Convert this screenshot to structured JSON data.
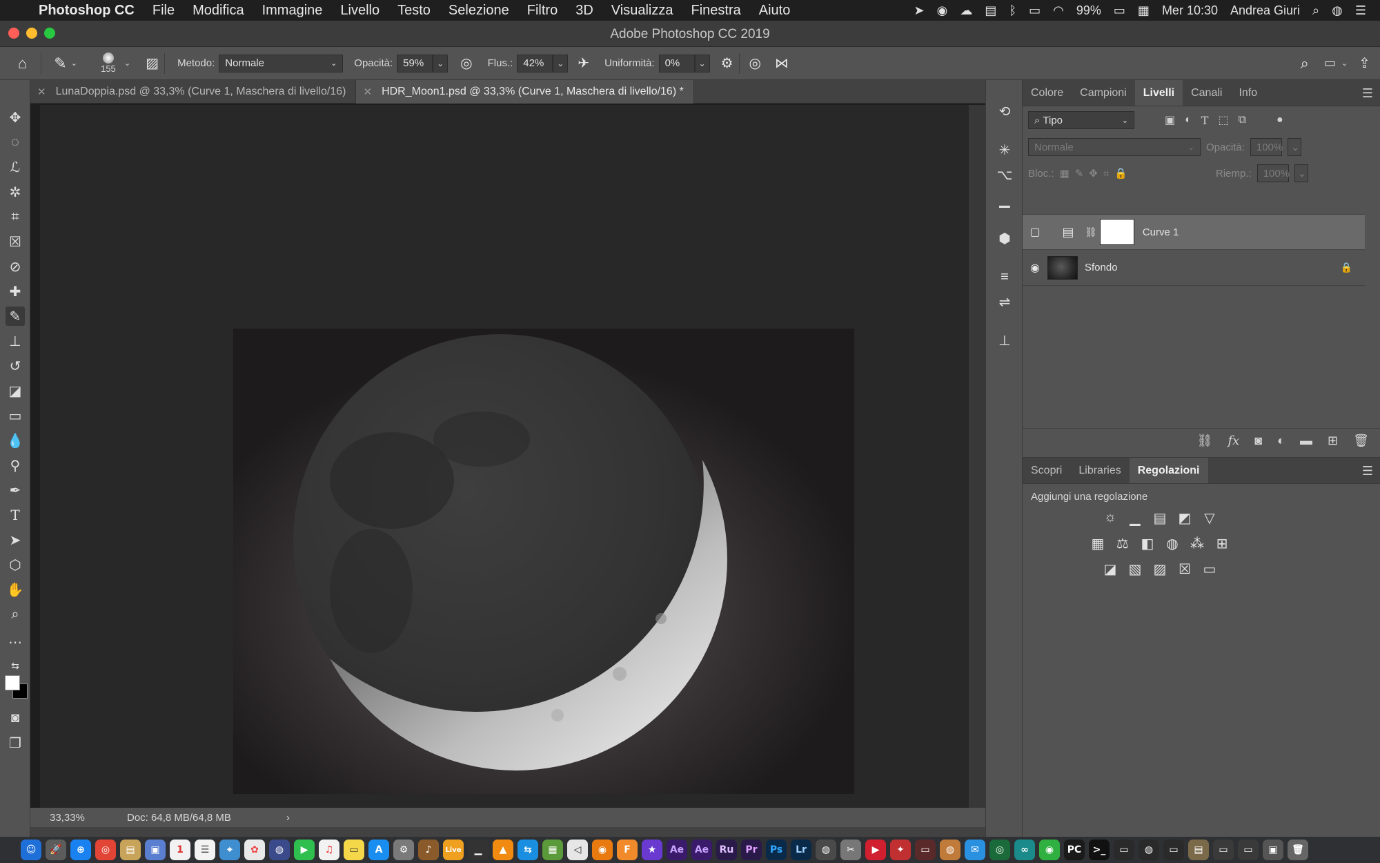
{
  "menubar": {
    "app_name": "Photoshop CC",
    "items": [
      "File",
      "Modifica",
      "Immagine",
      "Livello",
      "Testo",
      "Selezione",
      "Filtro",
      "3D",
      "Visualizza",
      "Finestra",
      "Aiuto"
    ],
    "battery": "99%",
    "clock": "Mer 10:30",
    "user": "Andrea Giuri"
  },
  "window": {
    "title": "Adobe Photoshop CC 2019"
  },
  "options": {
    "brush_size": "155",
    "metodo_label": "Metodo:",
    "metodo_value": "Normale",
    "opacita_label": "Opacità:",
    "opacita_value": "59%",
    "flusso_label": "Flus.:",
    "flusso_value": "42%",
    "uniformita_label": "Uniformità:",
    "uniformita_value": "0%"
  },
  "tabs": [
    {
      "label": "LunaDoppia.psd @ 33,3% (Curve 1, Maschera di livello/16)"
    },
    {
      "label": "HDR_Moon1.psd @ 33,3% (Curve 1, Maschera di livello/16) *"
    }
  ],
  "status": {
    "zoom": "33,33%",
    "doc": "Doc: 64,8 MB/64,8 MB"
  },
  "panel_top": {
    "tabs": [
      "Colore",
      "Campioni",
      "Livelli",
      "Canali",
      "Info"
    ],
    "active_tab": "Livelli",
    "filter_value": "Tipo",
    "blend_value": "Normale",
    "opacity_label": "Opacità:",
    "opacity_value": "100%",
    "lock_label": "Bloc.:",
    "fill_label": "Riemp.:",
    "fill_value": "100%",
    "layers": [
      {
        "name": "Curve 1"
      },
      {
        "name": "Sfondo"
      }
    ]
  },
  "panel_bottom": {
    "tabs": [
      "Scopri",
      "Libraries",
      "Regolazioni"
    ],
    "active_tab": "Regolazioni",
    "title": "Aggiungi una regolazione"
  },
  "colors": {
    "accent_close": "#ff5f57",
    "accent_min": "#febc2e",
    "accent_max": "#28c840",
    "ui_panel": "#535353",
    "canvas_bg": "#282828"
  }
}
